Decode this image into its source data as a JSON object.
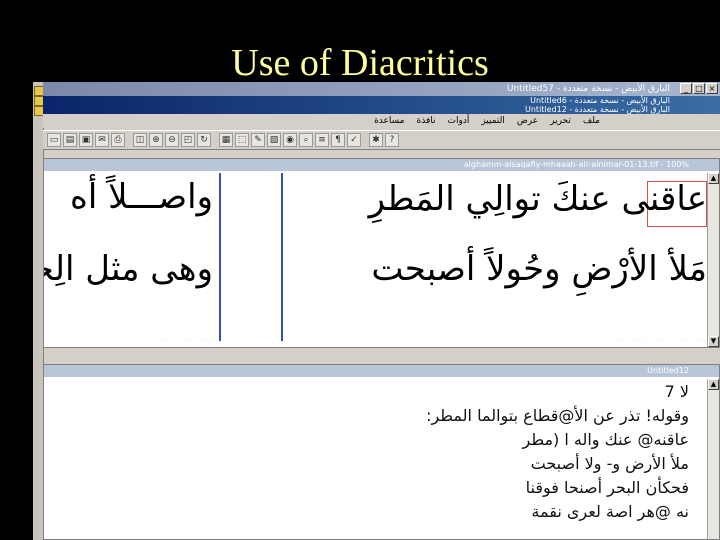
{
  "slide": {
    "title": "Use of Diacritics"
  },
  "windows": {
    "back_title": "البارق الأبيض - نسخة متعددة - Untitled57",
    "mid_title": "البارق الأبيض - نسخة متعددة - Untitled6",
    "front_title": "البارق الأبيض - نسخة متعددة - Untitled12"
  },
  "menu": {
    "items": [
      "ملف",
      "تحرير",
      "عرض",
      "التمييز",
      "أدوات",
      "نافذة",
      "مساعدة"
    ]
  },
  "document": {
    "title": "alghamm-alsaqafiy-mhaaah-alr-alnimar-01-13.tif - 100%",
    "right_lines": [
      "عاقنى عنكَ توالِي المَطرِ",
      "مَلأ الأرْضِ وحُولاً أصبحت",
      "ـ ـ ـ ـ ـ"
    ],
    "left_lines": [
      "واصـــلاً أه",
      "وهى مثل الِحبْ",
      "ـ ـ ـ"
    ]
  },
  "ocr_window": {
    "title": "Untitled12",
    "lines": [
      "لا 7",
      "وقوله! تذر عن الأ@قطاع بتوالما المطر:",
      "عاقنه@ عنك واله ا (مطر",
      "ملأ الأرض و- ولا أصبحت",
      "فحكأن البحر أصنحا فوقنا",
      "نه @هر اصة لعرى نقمة"
    ]
  }
}
